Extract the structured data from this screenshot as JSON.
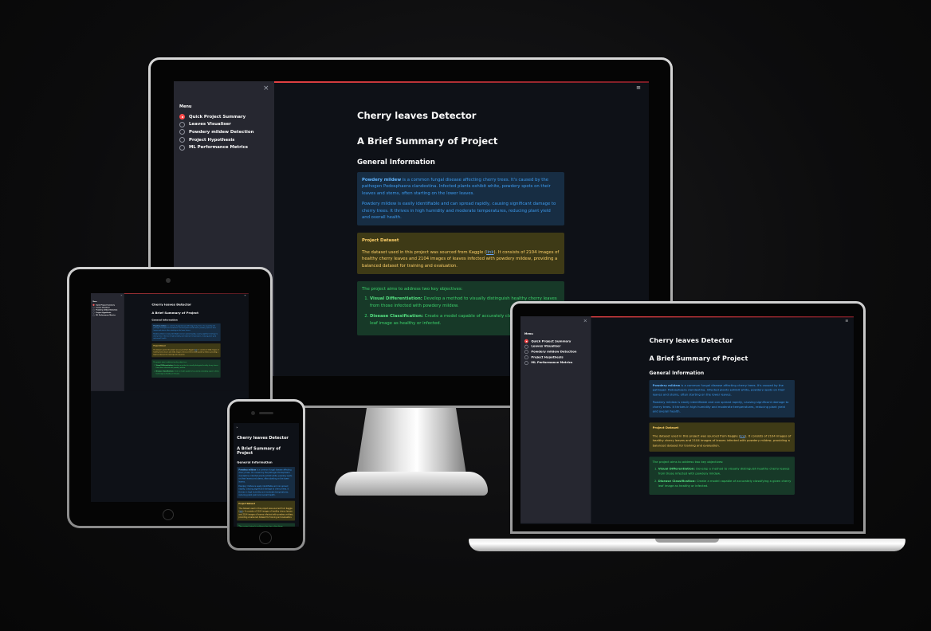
{
  "app": {
    "menu_title": "Menu",
    "close_symbol": "×",
    "hamburger_symbol": "≡",
    "expand_symbol": "›",
    "menu_items": [
      "Quick Project Summary",
      "Leaves Visualiser",
      "Powdery mildew Detection",
      "Project Hypothesis",
      "ML Performance Metrics"
    ],
    "selected_index": 0,
    "title": "Cherry leaves Detector",
    "subtitle": "A Brief Summary of Project",
    "section_heading": "General Information",
    "info_box": {
      "term": "Powdery mildew",
      "p1_rest": " is a common fungal disease affecting cherry trees. It's caused by the pathogen Podosphaera clandestina. Infected plants exhibit white, powdery spots on their leaves and stems, often starting on the lower leaves.",
      "p2": "Powdery mildew is easily identifiable and can spread rapidly, causing significant damage to cherry trees. It thrives in high humidity and moderate temperatures, reducing plant yield and overall health."
    },
    "warning_box": {
      "title": "Project Dataset",
      "text_before_link": "The dataset used in this project was sourced from Kaggle (",
      "link_text": "link",
      "text_after_link": "). It consists of 2104 images of healthy cherry leaves and 2104 images of leaves infected with powdery mildew, providing a balanced dataset for training and evaluation."
    },
    "success_box": {
      "intro": "The project aims to address two key objectives:",
      "objectives": [
        {
          "label": "Visual Differentiation:",
          "text": " Develop a method to visually distinguish healthy cherry leaves from those infected with powdery mildew."
        },
        {
          "label": "Disease Classification:",
          "text": " Create a model capable of accurately classifying a given cherry leaf image as healthy or infected."
        }
      ]
    }
  },
  "colors": {
    "background": "#0e1117",
    "sidebar": "#262730",
    "accent": "#ff4b4b",
    "info_bg": "#172d43",
    "warning_bg": "#3e3a16",
    "success_bg": "#173928"
  }
}
